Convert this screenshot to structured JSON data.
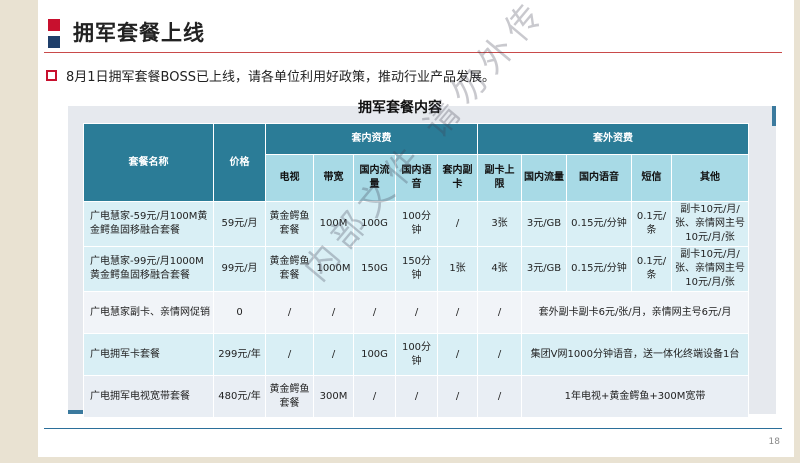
{
  "header": {
    "title": "拥军套餐上线",
    "subtitle": "8月1日拥军套餐BOSS已上线，请各单位利用好政策，推动行业产品发展。"
  },
  "table": {
    "title": "拥军套餐内容",
    "headers": {
      "name": "套餐名称",
      "price": "价格",
      "inner_group": "套内资费",
      "outer_group": "套外资费",
      "tv": "电视",
      "broadband": "带宽",
      "domestic_data": "国内流量",
      "domestic_voice": "国内语音",
      "inner_sub_card": "套内副卡",
      "sub_card_limit": "副卡上限",
      "outer_data": "国内流量",
      "outer_voice": "国内语音",
      "sms": "短信",
      "other": "其他"
    },
    "rows": [
      {
        "name": "广电慧家-59元/月100M黄金鳄鱼固移融合套餐",
        "price": "59元/月",
        "tv": "黄金鳄鱼套餐",
        "broadband": "100M",
        "data": "100G",
        "voice": "100分钟",
        "sub": "/",
        "sub_limit": "3张",
        "out_data": "3元/GB",
        "out_voice": "0.15元/分钟",
        "sms": "0.1元/条",
        "other": "副卡10元/月/张、亲情网主号10元/月/张"
      },
      {
        "name": "广电慧家-99元/月1000M黄金鳄鱼固移融合套餐",
        "price": "99元/月",
        "tv": "黄金鳄鱼套餐",
        "broadband": "1000M",
        "data": "150G",
        "voice": "150分钟",
        "sub": "1张",
        "sub_limit": "4张",
        "out_data": "3元/GB",
        "out_voice": "0.15元/分钟",
        "sms": "0.1元/条",
        "other": "副卡10元/月/张、亲情网主号10元/月/张"
      },
      {
        "name": "广电慧家副卡、亲情网促销",
        "price": "0",
        "tv": "/",
        "broadband": "/",
        "data": "/",
        "voice": "/",
        "sub": "/",
        "sub_limit": "/",
        "merged": "套外副卡副卡6元/张/月，亲情网主号6元/月"
      },
      {
        "name": "广电拥军卡套餐",
        "price": "299元/年",
        "tv": "/",
        "broadband": "/",
        "data": "100G",
        "voice": "100分钟",
        "sub": "/",
        "sub_limit": "/",
        "merged": "集团V网1000分钟语音，送一体化终端设备1台"
      },
      {
        "name": "广电拥军电视宽带套餐",
        "price": "480元/年",
        "tv": "黄金鳄鱼套餐",
        "broadband": "300M",
        "data": "/",
        "voice": "/",
        "sub": "/",
        "sub_limit": "/",
        "merged": "1年电视+黄金鳄鱼+300M宽带"
      }
    ]
  },
  "watermark": "内部文件 请勿外传",
  "page_number": "18",
  "colors": {
    "brand_red": "#c8102e",
    "brand_navy": "#1f3f6b",
    "header_teal": "#2b7c97",
    "subheader_light": "#a8dae6"
  }
}
